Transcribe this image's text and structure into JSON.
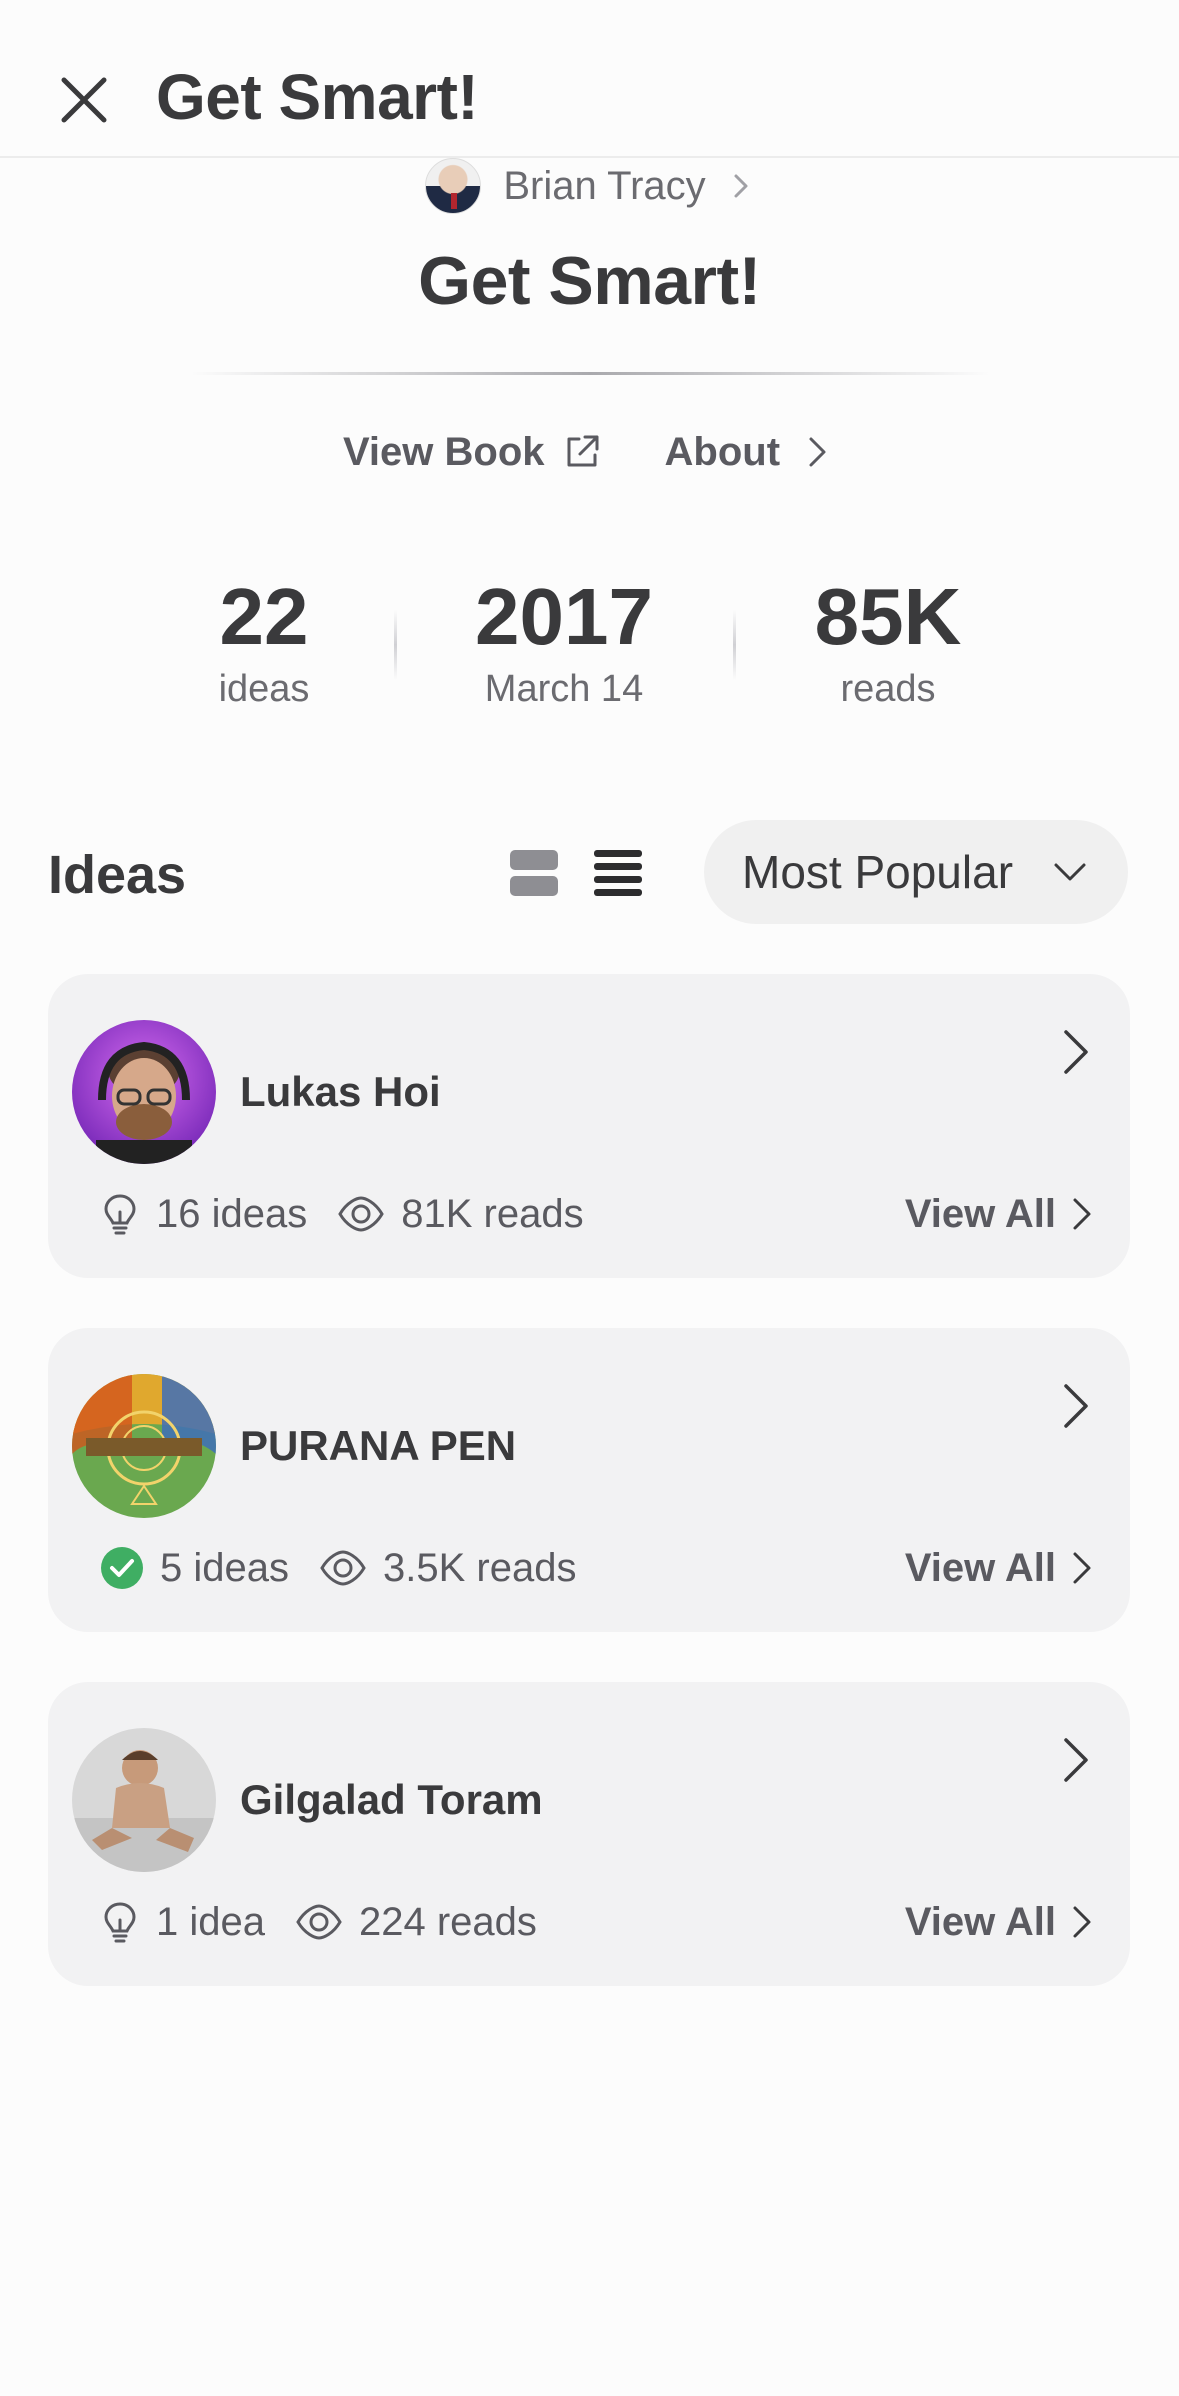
{
  "header": {
    "title": "Get Smart!"
  },
  "book": {
    "author": "Brian Tracy",
    "title": "Get Smart!",
    "links": {
      "view_book": "View Book",
      "about": "About"
    }
  },
  "stats": [
    {
      "value": "22",
      "label": "ideas"
    },
    {
      "value": "2017",
      "label": "March 14"
    },
    {
      "value": "85K",
      "label": "reads"
    }
  ],
  "ideas": {
    "heading": "Ideas",
    "sort": "Most Popular",
    "view_all_label": "View All",
    "cards": [
      {
        "name": "Lukas Hoi",
        "ideas": "16 ideas",
        "reads": "81K reads",
        "verified": false
      },
      {
        "name": "PURANA PEN",
        "ideas": "5 ideas",
        "reads": "3.5K reads",
        "verified": true
      },
      {
        "name": "Gilgalad Toram",
        "ideas": "1 idea",
        "reads": "224 reads",
        "verified": false
      }
    ]
  },
  "colors": {
    "text": "#3a3a3c",
    "muted": "#6b6b70",
    "card_bg": "#f2f2f3",
    "verified_green": "#3fae63"
  }
}
